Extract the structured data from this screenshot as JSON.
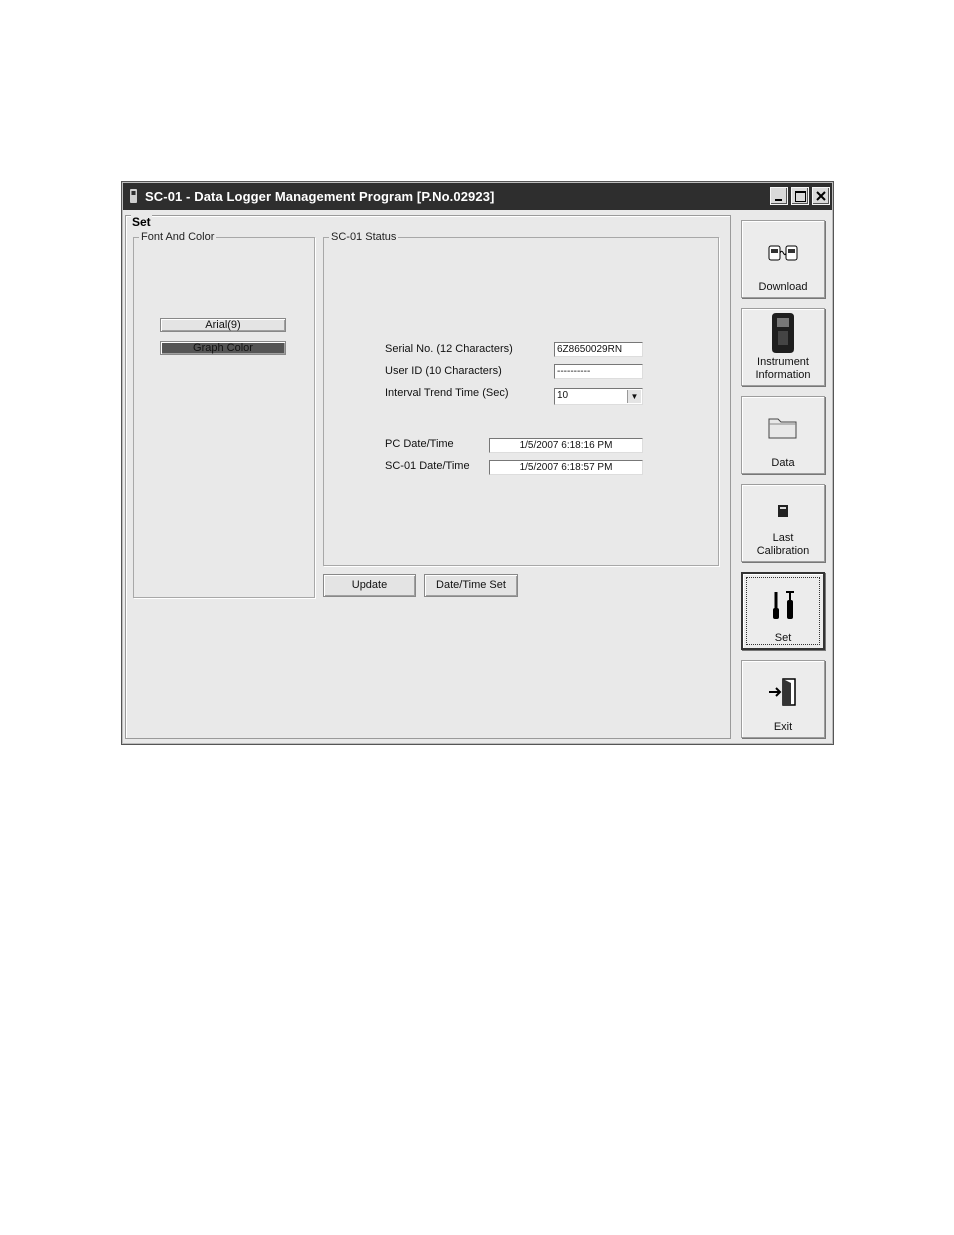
{
  "window": {
    "title": "SC-01 - Data Logger Management Program [P.No.02923]",
    "controls": [
      "minimize-icon",
      "maximize-icon",
      "close-icon"
    ]
  },
  "main": {
    "section_label": "Set",
    "font_color": {
      "group_label": "Font And Color",
      "font_button": "Arial(9)",
      "graph_color_button": "Graph Color",
      "graph_color_value": "#555555"
    },
    "status": {
      "group_label": "SC-01 Status",
      "serial_label": "Serial No. (12 Characters)",
      "serial_value": "6Z8650029RN",
      "userid_label": "User ID (10 Characters)",
      "userid_value": "----------",
      "interval_label": "Interval Trend Time (Sec)",
      "interval_value": "10",
      "pc_date_label": "PC Date/Time",
      "pc_date_value": "1/5/2007 6:18:16 PM",
      "sc_date_label": "SC-01 Date/Time",
      "sc_date_value": "1/5/2007 6:18:57 PM"
    },
    "update_button": "Update",
    "datetime_set_button": "Date/Time Set"
  },
  "nav": {
    "download": "Download",
    "instrument_line1": "Instrument",
    "instrument_line2": "Information",
    "data": "Data",
    "last_cal_line1": "Last",
    "last_cal_line2": "Calibration",
    "set": "Set",
    "exit": "Exit",
    "active": "Set"
  }
}
